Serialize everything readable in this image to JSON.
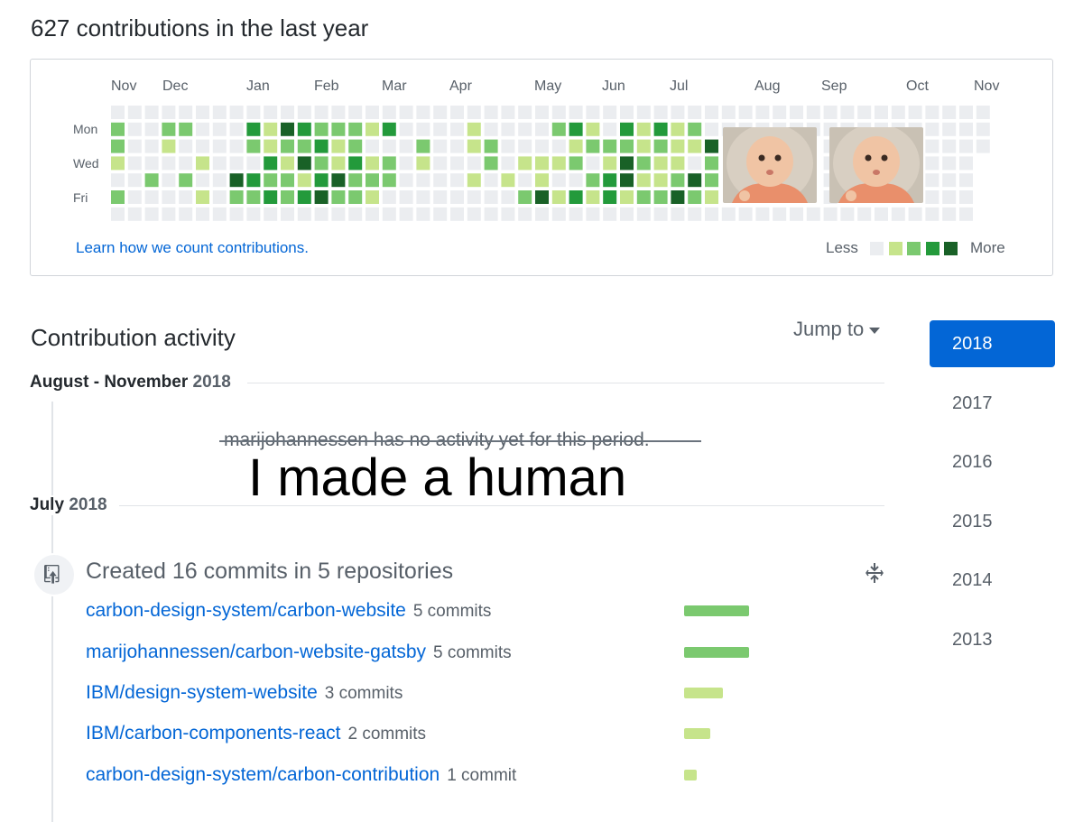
{
  "summary": {
    "heading": "627 contributions in the last year"
  },
  "calendar": {
    "months": [
      "Nov",
      "Dec",
      "Jan",
      "Feb",
      "Mar",
      "Apr",
      "May",
      "Jun",
      "Jul",
      "Aug",
      "Sep",
      "Oct",
      "Nov"
    ],
    "weekdays": [
      "Mon",
      "Wed",
      "Fri"
    ],
    "colors": [
      "#ebedf0",
      "#c6e48b",
      "#7bc96f",
      "#239a3b",
      "#196127"
    ],
    "weeks": [
      [
        0,
        2,
        2,
        1,
        0,
        2,
        0
      ],
      [
        0,
        0,
        0,
        0,
        0,
        0,
        0
      ],
      [
        0,
        0,
        0,
        0,
        2,
        0,
        0
      ],
      [
        0,
        2,
        1,
        0,
        0,
        0,
        0
      ],
      [
        0,
        2,
        0,
        0,
        2,
        0,
        0
      ],
      [
        0,
        0,
        0,
        1,
        0,
        1,
        0
      ],
      [
        0,
        0,
        0,
        0,
        0,
        0,
        0
      ],
      [
        0,
        0,
        0,
        0,
        4,
        2,
        0
      ],
      [
        0,
        3,
        2,
        0,
        3,
        2,
        0
      ],
      [
        0,
        1,
        1,
        3,
        2,
        3,
        0
      ],
      [
        0,
        4,
        2,
        1,
        2,
        2,
        0
      ],
      [
        0,
        3,
        2,
        4,
        1,
        3,
        0
      ],
      [
        0,
        2,
        3,
        2,
        3,
        4,
        0
      ],
      [
        0,
        2,
        1,
        1,
        4,
        2,
        0
      ],
      [
        0,
        2,
        2,
        3,
        2,
        2,
        0
      ],
      [
        0,
        1,
        0,
        1,
        2,
        1,
        0
      ],
      [
        0,
        3,
        0,
        2,
        2,
        0,
        0
      ],
      [
        0,
        0,
        0,
        0,
        0,
        0,
        0
      ],
      [
        0,
        0,
        2,
        1,
        0,
        0,
        0
      ],
      [
        0,
        0,
        0,
        0,
        0,
        0,
        0
      ],
      [
        0,
        0,
        0,
        0,
        0,
        0,
        0
      ],
      [
        0,
        1,
        1,
        0,
        1,
        0,
        0
      ],
      [
        0,
        0,
        2,
        2,
        0,
        0,
        0
      ],
      [
        0,
        0,
        0,
        0,
        1,
        0,
        0
      ],
      [
        0,
        0,
        0,
        1,
        0,
        2,
        0
      ],
      [
        0,
        0,
        0,
        1,
        1,
        4,
        0
      ],
      [
        0,
        2,
        0,
        1,
        0,
        1,
        0
      ],
      [
        0,
        3,
        1,
        2,
        0,
        3,
        0
      ],
      [
        0,
        1,
        2,
        0,
        2,
        1,
        0
      ],
      [
        0,
        0,
        2,
        1,
        3,
        3,
        0
      ],
      [
        0,
        3,
        2,
        4,
        4,
        1,
        0
      ],
      [
        0,
        1,
        1,
        2,
        1,
        2,
        0
      ],
      [
        0,
        3,
        2,
        1,
        1,
        2,
        0
      ],
      [
        0,
        1,
        1,
        1,
        2,
        4,
        0
      ],
      [
        0,
        2,
        1,
        0,
        4,
        2,
        0
      ],
      [
        0,
        0,
        4,
        2,
        2,
        1,
        0
      ]
    ],
    "photos": [
      {
        "name": "baby-photo-aug",
        "alt": "baby photo"
      },
      {
        "name": "baby-photo-sep",
        "alt": "baby photo"
      }
    ],
    "learn_link": "Learn how we count contributions.",
    "legend_less": "Less",
    "legend_more": "More"
  },
  "activity": {
    "title": "Contribution activity",
    "jump_to": "Jump to",
    "periods": [
      {
        "label": "August - November",
        "year": "2018"
      },
      {
        "label": "July",
        "year": "2018"
      }
    ],
    "no_activity": "marijohannessen has no activity yet for this period.",
    "overlay_text": "I made a human",
    "created_summary": "Created 16 commits in 5 repositories",
    "repos": [
      {
        "name": "carbon-design-system/carbon-website",
        "count_label": "5 commits",
        "commits": 5
      },
      {
        "name": "marijohannessen/carbon-website-gatsby",
        "count_label": "5 commits",
        "commits": 5
      },
      {
        "name": "IBM/design-system-website",
        "count_label": "3 commits",
        "commits": 3
      },
      {
        "name": "IBM/carbon-components-react",
        "count_label": "2 commits",
        "commits": 2
      },
      {
        "name": "carbon-design-system/carbon-contribution",
        "count_label": "1 commit",
        "commits": 1
      }
    ]
  },
  "years": {
    "selected": "2018",
    "list": [
      "2018",
      "2017",
      "2016",
      "2015",
      "2014",
      "2013"
    ]
  }
}
